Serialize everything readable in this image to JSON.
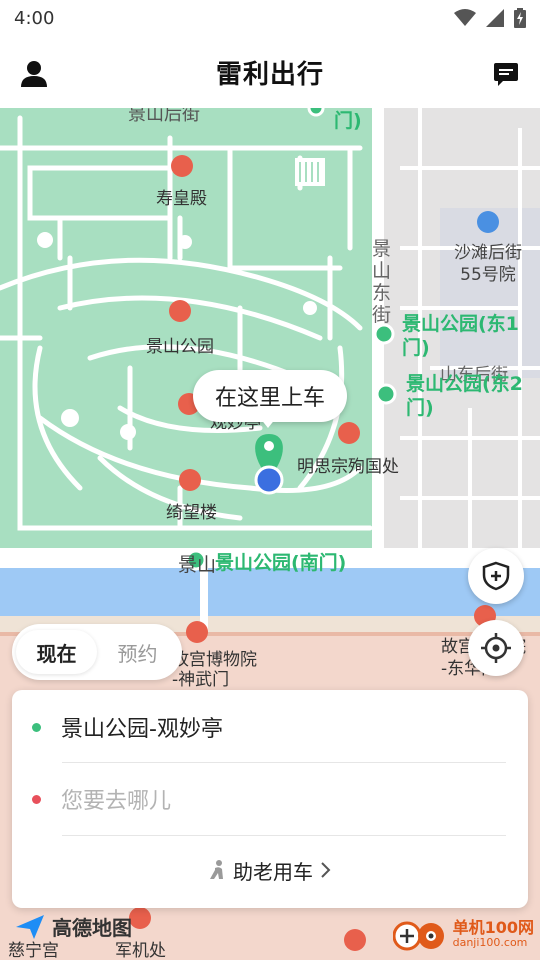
{
  "status_bar": {
    "time": "4:00"
  },
  "header": {
    "title": "雷利出行"
  },
  "map": {
    "labels": {
      "top_partial": "景山后街",
      "top_gate_partial": "门)",
      "shouhuang": "寿皇殿",
      "jingshan_park": "景山公园",
      "street_vertical": "景山东街",
      "shatan_line1": "沙滩后街",
      "shatan_line2": "55号院",
      "east1_line1": "景山公园(东1",
      "east1_line2": "门)",
      "east2_line1": "景山公园(东2",
      "east2_line2": "门)",
      "east_street_partial": "山东后街",
      "mingsi": "明思宗殉国处",
      "qiwang": "绮望楼",
      "south_gate_prefix": "景山",
      "south_gate": "景山公园(南门)",
      "guanmiao_partial": "观妙亭",
      "palace_north_line1": "故宫博物院",
      "palace_north_line2": "-神武门",
      "palace_east_line1": "故宫博物院",
      "palace_east_line2": "-东华门",
      "cining": "慈宁宫",
      "junji": "军机处"
    },
    "pickup_bubble": "在这里上车",
    "logo_text": "高德地图"
  },
  "time_tabs": {
    "now": "现在",
    "reserve": "预约"
  },
  "trip": {
    "pickup": "景山公园-观妙亭",
    "destination_placeholder": "您要去哪儿",
    "elder_label": "助老用车"
  },
  "watermark": {
    "text": "单机100网",
    "sub": "danji100.com"
  },
  "colors": {
    "park_green": "#a8dfc1",
    "water_blue": "#9ec9f5",
    "poi_red": "#e8604c",
    "pin_green": "#3cbf7d",
    "location_blue": "#3b6fe0",
    "dest_dot": "#e8505b"
  }
}
